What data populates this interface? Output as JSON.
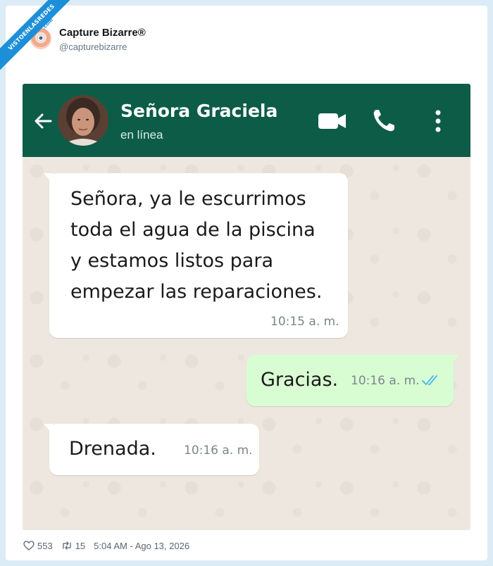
{
  "watermark": {
    "text": "VISTOENLASREDES",
    "suffix": ".com"
  },
  "post": {
    "author_name": "Capture Bizarre®",
    "author_handle": "@capturebizarre",
    "likes": "553",
    "retweets": "15",
    "timestamp": "5:04 AM - Ago 13, 2026"
  },
  "chat": {
    "contact_name": "Señora Graciela",
    "status": "en línea",
    "header_color": "#0d5c48",
    "messages": [
      {
        "direction": "incoming",
        "lines": [
          "Señora, ya le escurrimos",
          "toda el agua de la piscina",
          "y estamos listos para",
          "empezar las reparaciones."
        ],
        "time": "10:15 a. m."
      },
      {
        "direction": "outgoing",
        "text": "Gracias.",
        "time": "10:16 a. m.",
        "read": true
      },
      {
        "direction": "incoming",
        "text": "Drenada.",
        "time": "10:16 a. m."
      }
    ]
  },
  "colors": {
    "outgoing_bubble": "#d9fdd3",
    "incoming_bubble": "#ffffff",
    "read_ticks": "#53bdeb"
  },
  "icons": [
    "back-arrow-icon",
    "video-call-icon",
    "phone-icon",
    "more-options-icon",
    "read-ticks-icon",
    "heart-icon",
    "retweet-icon"
  ]
}
